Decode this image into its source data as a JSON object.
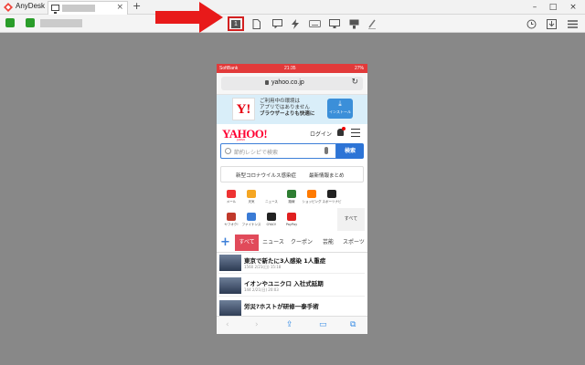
{
  "app": {
    "name": "AnyDesk"
  },
  "tab": {
    "close": "×",
    "add": "+"
  },
  "window": {
    "minimize": "–",
    "maximize": "□",
    "close": "×"
  },
  "toolbar": {
    "display_number": "1"
  },
  "accent": {
    "highlight": "#d32020",
    "yahoo_red": "#ff0033",
    "search_blue": "#2d74d6",
    "news_tab_active": "#e14a5a"
  },
  "phone": {
    "status": {
      "carrier": "SoftBank",
      "time": "21:35",
      "battery": "27%"
    },
    "url": "yahoo.co.jp",
    "banner": {
      "logo": "Y!",
      "line1": "ご利用中の環境は",
      "line2": "アプリではありません",
      "line3": "ブラウザーよりも快適に",
      "install": "インストール"
    },
    "header": {
      "logo": "YAHOO!",
      "logo_sub": "JAPAN",
      "login": "ログイン"
    },
    "search": {
      "placeholder": "節約レシピで検索",
      "button": "検索"
    },
    "news_strip": {
      "item1": "新型コロナウイルス感染症",
      "item2": "最新情報まとめ"
    },
    "services": [
      {
        "label": "メール",
        "color": "#e33"
      },
      {
        "label": "天気",
        "color": "#f5a623"
      },
      {
        "label": "ニュース",
        "color": "#fff"
      },
      {
        "label": "路線",
        "color": "#2e7d32"
      },
      {
        "label": "ショッピング",
        "color": "#ff7a00"
      },
      {
        "label": "スポーツナビ",
        "color": "#222"
      },
      {
        "label": "ヤフオク!",
        "color": "#c0392b"
      },
      {
        "label": "ファイナンス",
        "color": "#3a7bd5"
      },
      {
        "label": "GYAO!",
        "color": "#222"
      },
      {
        "label": "PayPay",
        "color": "#e02020"
      }
    ],
    "services_more": "すべて",
    "news_tabs": [
      "すべて",
      "ニュース",
      "クーポン",
      "芸能",
      "スポーツ"
    ],
    "articles": [
      {
        "title": "東京で新たに3人感染 1人重症",
        "meta": "1560  2/21(日) 15:18"
      },
      {
        "title": "イオンやユニクロ 入社式延期",
        "meta": "144  2/21(日) 20:03"
      },
      {
        "title": "労災?ホストが研修一泰手術",
        "meta": ""
      }
    ],
    "bottom": {
      "back": "‹",
      "forward": "›",
      "share": "⇪",
      "bookmarks": "▭",
      "tabs": "⧉"
    }
  }
}
